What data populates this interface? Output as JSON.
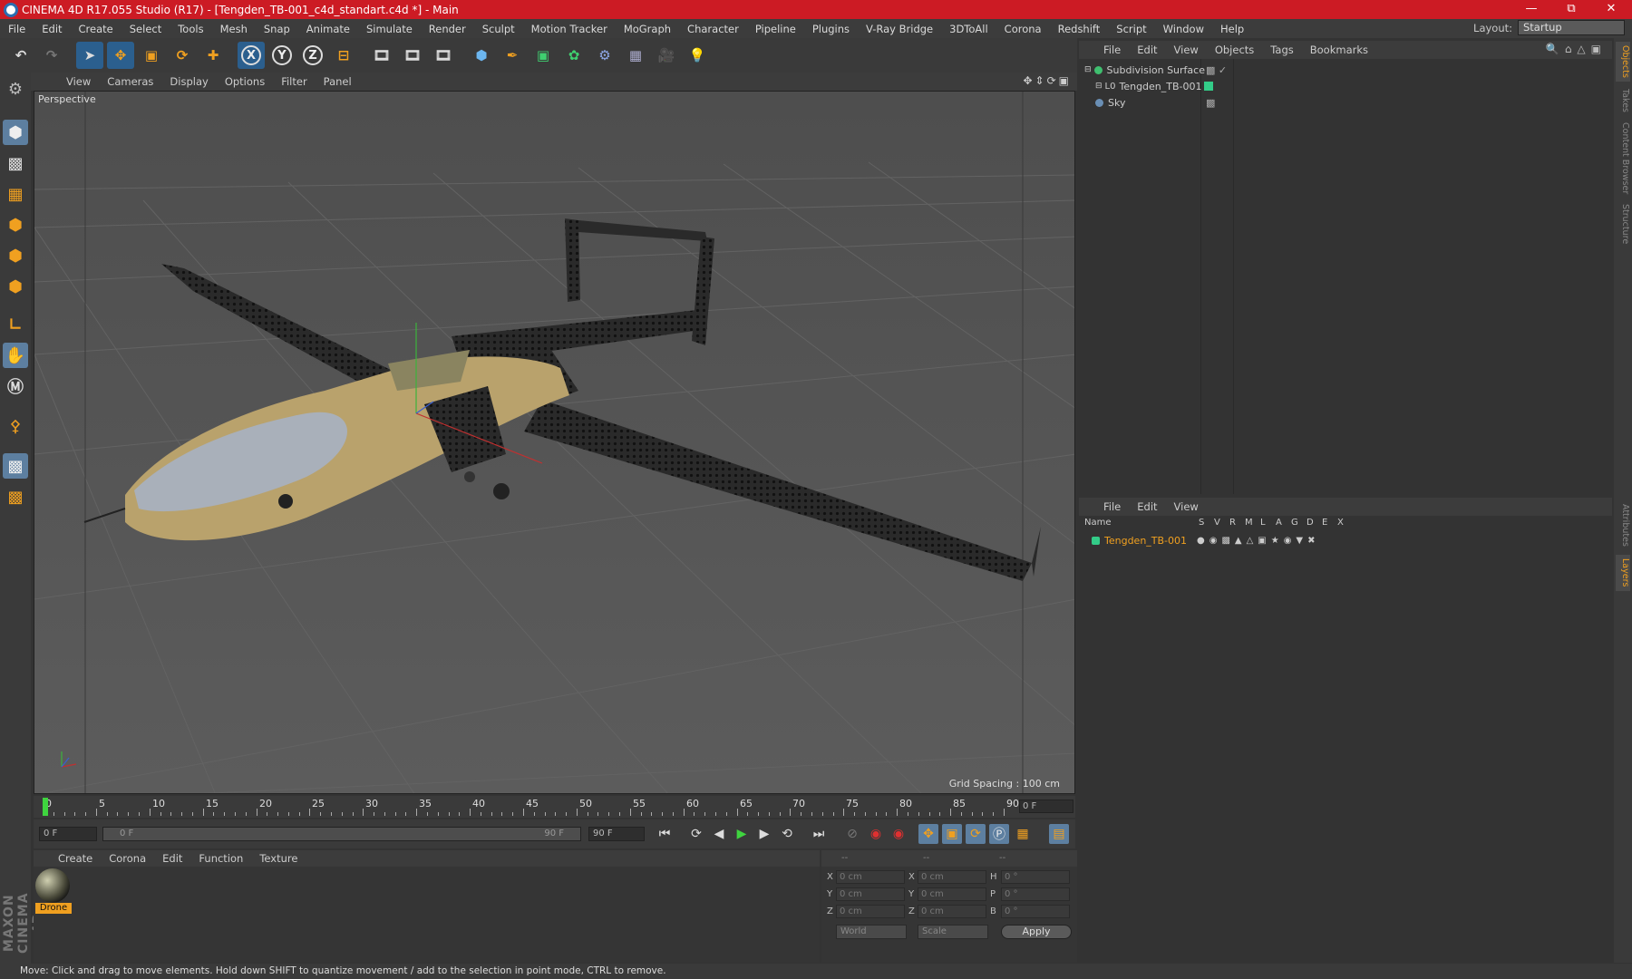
{
  "window": {
    "title": "CINEMA 4D R17.055 Studio (R17) - [Tengden_TB-001_c4d_standart.c4d *] - Main"
  },
  "menubar": {
    "items": [
      "File",
      "Edit",
      "Create",
      "Select",
      "Tools",
      "Mesh",
      "Snap",
      "Animate",
      "Simulate",
      "Render",
      "Sculpt",
      "Motion Tracker",
      "MoGraph",
      "Character",
      "Pipeline",
      "Plugins",
      "V-Ray Bridge",
      "3DToAll",
      "Corona",
      "Redshift",
      "Script",
      "Window",
      "Help"
    ],
    "layout_label": "Layout:",
    "layout_value": "Startup"
  },
  "toolbar": {
    "icons": [
      "undo-icon",
      "redo-icon",
      "select-arrow-icon",
      "move-icon",
      "scale-icon",
      "rotate-icon",
      "live-select-icon",
      "x-axis-icon",
      "y-axis-icon",
      "z-axis-icon",
      "world-coordinates-icon",
      "render-view-icon",
      "render-picture-viewer-icon",
      "edit-render-settings-icon",
      "cube-icon",
      "pen-spline-icon",
      "subdivision-icon",
      "cloner-icon",
      "deformer-icon",
      "floor-icon",
      "camera-icon",
      "light-icon"
    ],
    "axis_x": "X",
    "axis_y": "Y",
    "axis_z": "Z"
  },
  "viewport": {
    "menu": [
      "View",
      "Cameras",
      "Display",
      "Options",
      "Filter",
      "Panel"
    ],
    "label": "Perspective",
    "grid_spacing": "Grid Spacing : 100 cm"
  },
  "timeline": {
    "ticks": [
      "0",
      "5",
      "10",
      "15",
      "20",
      "25",
      "30",
      "35",
      "40",
      "45",
      "50",
      "55",
      "60",
      "65",
      "70",
      "75",
      "80",
      "85",
      "90"
    ],
    "current_frame": "0 F"
  },
  "transport": {
    "start_field": "0 F",
    "slider_start": "0 F",
    "slider_end": "90 F",
    "end_field": "90 F"
  },
  "materials": {
    "menu": [
      "Create",
      "Corona",
      "Edit",
      "Function",
      "Texture"
    ],
    "items": [
      {
        "name": "Drone"
      }
    ]
  },
  "coordinates": {
    "headers": [
      "--",
      "--",
      "--"
    ],
    "rows": [
      {
        "a": "X",
        "av": "0 cm",
        "b": "X",
        "bv": "0 cm",
        "c": "H",
        "cv": "0 °"
      },
      {
        "a": "Y",
        "av": "0 cm",
        "b": "Y",
        "bv": "0 cm",
        "c": "P",
        "cv": "0 °"
      },
      {
        "a": "Z",
        "av": "0 cm",
        "b": "Z",
        "bv": "0 cm",
        "c": "B",
        "cv": "0 °"
      }
    ],
    "mode1": "World",
    "mode2": "Scale",
    "apply": "Apply"
  },
  "objects": {
    "menu": [
      "File",
      "Edit",
      "View",
      "Objects",
      "Tags",
      "Bookmarks"
    ],
    "items": [
      {
        "name": "Subdivision Surface",
        "color": "#3fbf6f"
      },
      {
        "name": "Tengden_TB-001",
        "color": "#33cc88"
      },
      {
        "name": "Sky",
        "color": "#6a8fb5"
      }
    ]
  },
  "layers": {
    "menu": [
      "File",
      "Edit",
      "View"
    ],
    "columns": [
      "Name",
      "S",
      "V",
      "R",
      "M",
      "L",
      "A",
      "G",
      "D",
      "E",
      "X"
    ],
    "items": [
      {
        "name": "Tengden_TB-001",
        "color": "#33cc88"
      }
    ]
  },
  "right_tabs": [
    "Objects",
    "Takes",
    "Content Browser",
    "Structure",
    "Attributes",
    "Layers"
  ],
  "status": "Move: Click and drag to move elements. Hold down SHIFT to quantize movement / add to the selection in point mode, CTRL to remove.",
  "branding": "MAXON CINEMA 4D",
  "accent": "#f0a020",
  "title_color": "#cc1b24"
}
